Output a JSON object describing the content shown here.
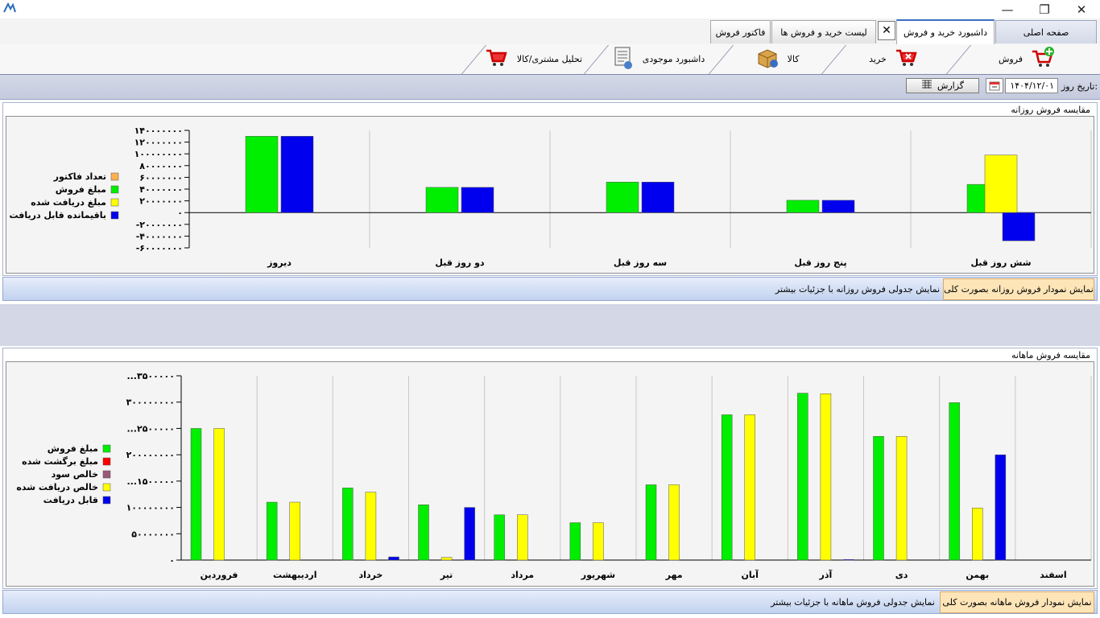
{
  "window": {
    "close_glyph": "✕",
    "restore_glyph": "❐",
    "minimize_glyph": "—"
  },
  "tabs": [
    {
      "label": "صفحه اصلی"
    },
    {
      "label": "داشبورد خرید و فروش"
    },
    {
      "label": "لیست خرید و فروش ها"
    },
    {
      "label": "فاکتور فروش"
    }
  ],
  "tab_close_glyph": "✕",
  "toolbar": [
    {
      "label": "فروش",
      "icon": "add-cart-icon"
    },
    {
      "label": "خرید",
      "icon": "cart-remove-icon"
    },
    {
      "label": "کالا",
      "icon": "product-box-icon"
    },
    {
      "label": "داشبورد موجودی",
      "icon": "inventory-report-icon"
    },
    {
      "label": "تحلیل مشتری/کالا",
      "icon": "cart-analysis-icon"
    }
  ],
  "datebar": {
    "date_label": "تاریخ روز:",
    "date_value": "۱۴۰۴/۱۲/۰۱",
    "report_label": "گزارش"
  },
  "colors": {
    "green": "#00ee00",
    "blue": "#0000ee",
    "yellow": "#ffff00",
    "orange": "#ffb050",
    "red": "#ff0000",
    "purple": "#9a5878"
  },
  "daily": {
    "title": "مقایسه فروش روزانه",
    "link_selected": "نمایش نمودار فروش روزانه بصورت کلی",
    "link_other": "نمایش جدولی فروش روزانه با جزئیات بیشتر",
    "chart_data": {
      "type": "bar",
      "categories": [
        "دیروز",
        "دو روز قبل",
        "سه روز قبل",
        "پنج روز قبل",
        "شش روز قبل"
      ],
      "series": [
        {
          "name": "تعداد فاکتور",
          "color": "#ffb050",
          "values": [
            0,
            0,
            0,
            0,
            0
          ]
        },
        {
          "name": "مبلغ فروش",
          "color": "#00ee00",
          "values": [
            130000000,
            43000000,
            52000000,
            21000000,
            48000000
          ]
        },
        {
          "name": "مبلغ دریافت شده",
          "color": "#ffff00",
          "values": [
            0,
            0,
            0,
            0,
            98000000
          ]
        },
        {
          "name": "باقیمانده قابل دریافت",
          "color": "#0000ee",
          "values": [
            130000000,
            43000000,
            52000000,
            21000000,
            -48000000
          ]
        }
      ],
      "yticks": [
        "۱۴۰۰۰۰۰۰۰",
        "۱۲۰۰۰۰۰۰۰",
        "۱۰۰۰۰۰۰۰۰",
        "۸۰۰۰۰۰۰۰",
        "۶۰۰۰۰۰۰۰",
        "۴۰۰۰۰۰۰۰",
        "۲۰۰۰۰۰۰۰",
        "۰",
        "-۲۰۰۰۰۰۰۰",
        "-۴۰۰۰۰۰۰۰",
        "-۶۰۰۰۰۰۰۰"
      ],
      "ylim": [
        -60000000,
        140000000
      ],
      "grid": true,
      "legend_position": "left"
    }
  },
  "monthly": {
    "title": "مقایسه فروش ماهانه",
    "link_selected": "نمایش نمودار فروش ماهانه بصورت کلی",
    "link_other": "نمایش جدولی فروش ماهانه با جزئیات بیشتر",
    "chart_data": {
      "type": "bar",
      "categories": [
        "فروردین",
        "اردیبهشت",
        "خرداد",
        "تیر",
        "مرداد",
        "شهریور",
        "مهر",
        "آبان",
        "آذر",
        "دی",
        "بهمن",
        "اسفند"
      ],
      "series": [
        {
          "name": "مبلغ فروش",
          "color": "#00ee00",
          "values": [
            250000000,
            110000000,
            137000000,
            105000000,
            86000000,
            71000000,
            143000000,
            276000000,
            317000000,
            235000000,
            299000000,
            0
          ]
        },
        {
          "name": "مبلغ برگشت شده",
          "color": "#ff0000",
          "values": [
            0,
            0,
            0,
            0,
            0,
            0,
            0,
            0,
            0,
            0,
            0,
            0
          ]
        },
        {
          "name": "خالص سود",
          "color": "#9a5878",
          "values": [
            0,
            0,
            0,
            0,
            0,
            0,
            0,
            0,
            0,
            0,
            0,
            0
          ]
        },
        {
          "name": "خالص دریافت شده",
          "color": "#ffff00",
          "values": [
            250000000,
            110000000,
            129000000,
            5000000,
            86000000,
            71000000,
            143000000,
            276000000,
            316000000,
            235000000,
            99000000,
            0
          ]
        },
        {
          "name": "قابل دریافت",
          "color": "#0000ee",
          "values": [
            0,
            0,
            6000000,
            100000000,
            0,
            0,
            0,
            0,
            1000000,
            0,
            200000000,
            0
          ]
        }
      ],
      "yticks": [
        "...۳۵۰۰۰۰۰",
        "۳۰۰۰۰۰۰۰۰",
        "...۲۵۰۰۰۰۰",
        "۲۰۰۰۰۰۰۰۰",
        "...۱۵۰۰۰۰۰",
        "۱۰۰۰۰۰۰۰۰",
        "۵۰۰۰۰۰۰۰",
        "۰"
      ],
      "ylim": [
        0,
        350000000
      ],
      "grid": true,
      "legend_position": "left"
    }
  }
}
